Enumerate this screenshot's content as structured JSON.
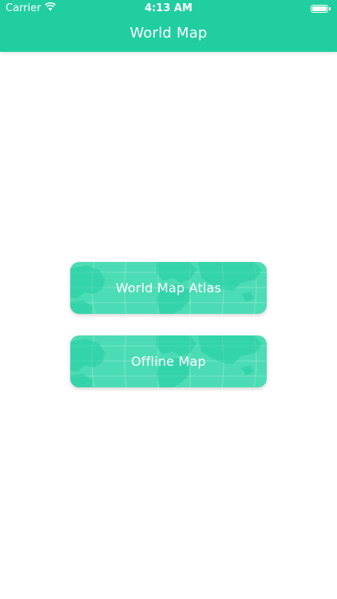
{
  "status_bar": {
    "carrier": "Carrier",
    "time": "4:13 AM",
    "battery_level_percent": 100
  },
  "header": {
    "title": "World Map"
  },
  "buttons": {
    "atlas_label": "World Map Atlas",
    "offline_label": "Offline Map"
  },
  "colors": {
    "header_bg": "#21cea0",
    "button_bg": "#4cdcb5",
    "button_land": "#21cea0"
  }
}
